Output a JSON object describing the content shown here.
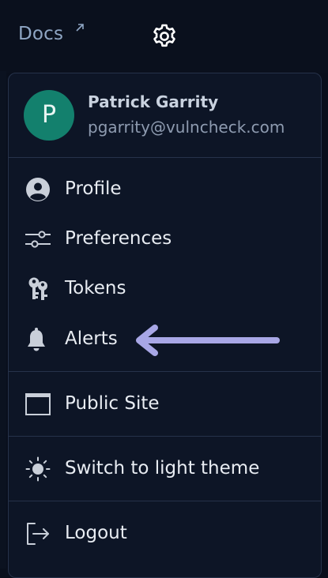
{
  "topbar": {
    "docs_label": "Docs"
  },
  "user": {
    "initial": "P",
    "name": "Patrick Garrity",
    "email": "pgarrity@vulncheck.com"
  },
  "menu": {
    "items": [
      {
        "label": "Profile",
        "icon": "user-circle-icon"
      },
      {
        "label": "Preferences",
        "icon": "sliders-icon"
      },
      {
        "label": "Tokens",
        "icon": "keys-icon"
      },
      {
        "label": "Alerts",
        "icon": "bell-icon"
      },
      {
        "label": "Public Site",
        "icon": "window-icon"
      },
      {
        "label": "Switch to light theme",
        "icon": "sun-icon"
      },
      {
        "label": "Logout",
        "icon": "logout-icon"
      }
    ]
  },
  "colors": {
    "background": "#090f1c",
    "menu_bg": "#0d1526",
    "avatar": "#13806d",
    "arrow": "#a8a7e6"
  }
}
